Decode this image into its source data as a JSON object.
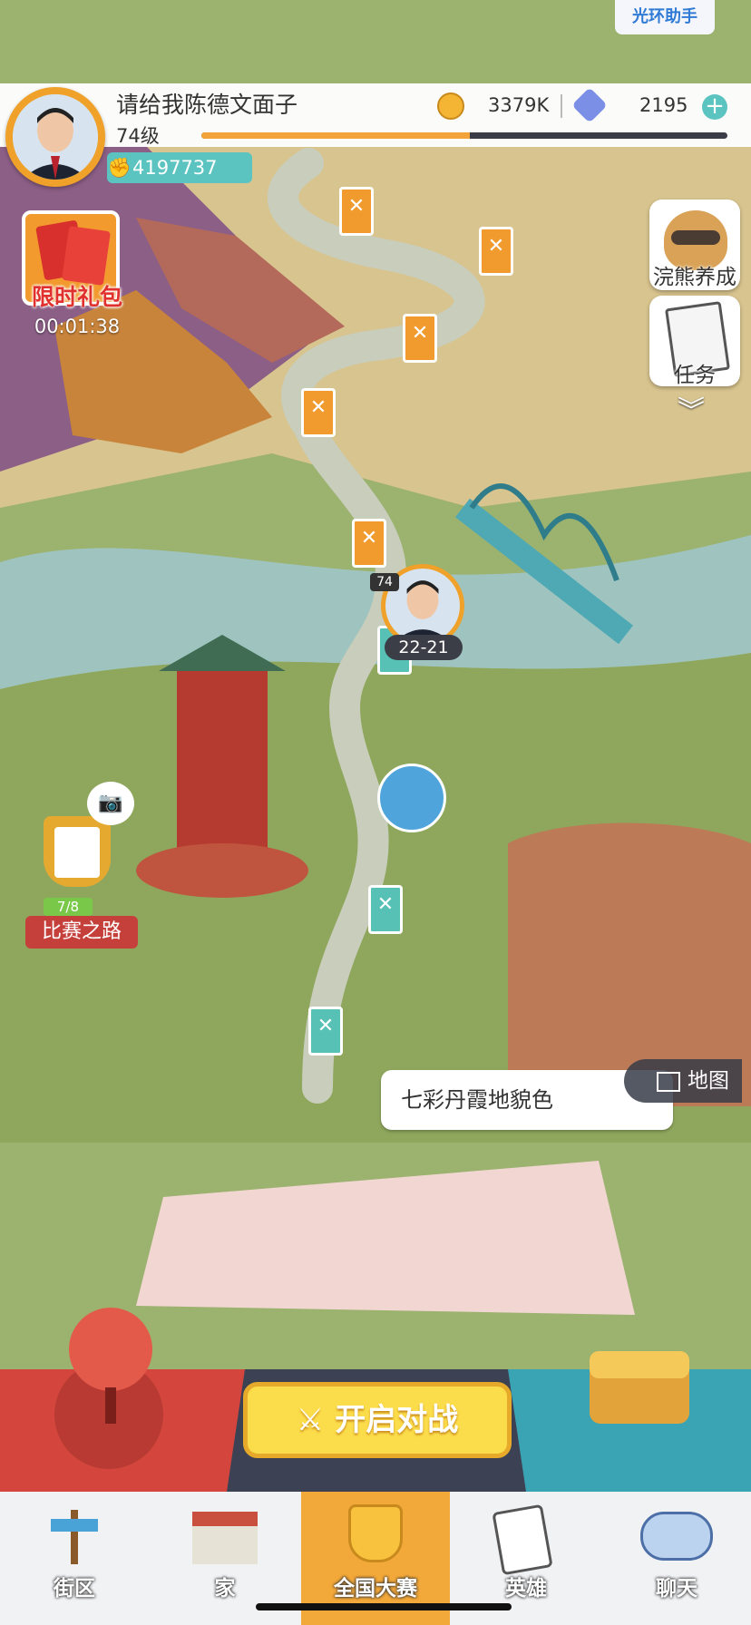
{
  "header": {
    "helper_label": "光环助手",
    "player_name": "请给我陈德文面子",
    "level_label": "74级",
    "coins": "3379K",
    "gems": "2195",
    "power": "4197737",
    "xp_progress": 0.51
  },
  "left_panel": {
    "gift_label": "限时礼包",
    "gift_timer": "00:01:38",
    "trophy_label": "比赛之路",
    "trophy_progress": "7/8"
  },
  "right_panel": {
    "raccoon_label": "浣熊养成",
    "task_label": "任务"
  },
  "map": {
    "player_level": "74",
    "player_score": "22-21",
    "scene_name": "七彩丹霞地貌色",
    "map_button": "地图"
  },
  "battle": {
    "start_label": "开启对战"
  },
  "nav": {
    "items": [
      {
        "label": "街区"
      },
      {
        "label": "家"
      },
      {
        "label": "全国大赛"
      },
      {
        "label": "英雄"
      },
      {
        "label": "聊天"
      }
    ],
    "active_index": 2
  },
  "colors": {
    "accent_orange": "#f2a43a",
    "accent_teal": "#57c1b6",
    "gift_red": "#e0312f"
  }
}
